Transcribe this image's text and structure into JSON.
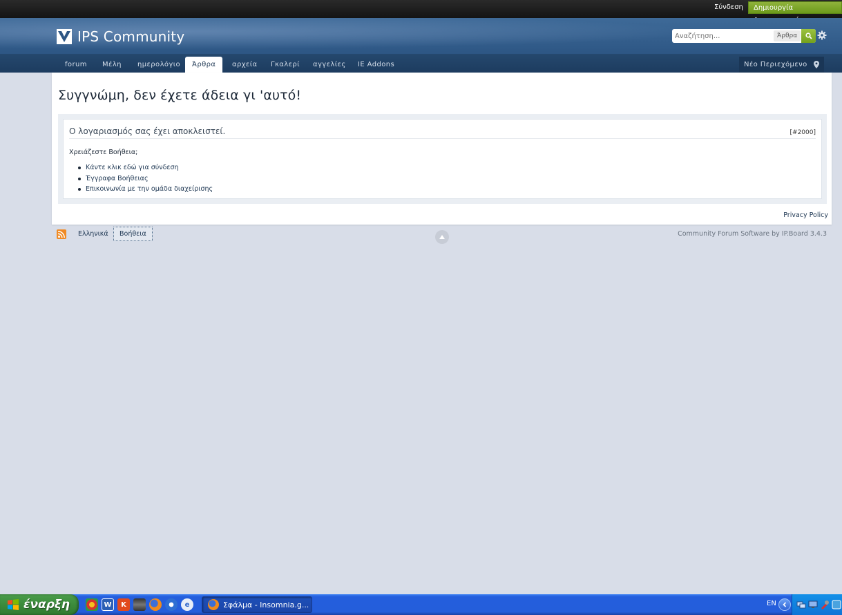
{
  "userbar": {
    "signin_label": "Σύνδεση",
    "register_label": "Δημιουργία Λογαριασμού"
  },
  "header": {
    "logo_text": "IPS Community",
    "search_placeholder": "Αναζήτηση...",
    "search_scope": "Άρθρα"
  },
  "nav": {
    "tabs": [
      {
        "label": "forum"
      },
      {
        "label": "Μέλη"
      },
      {
        "label": "ημερολόγιο"
      },
      {
        "label": "Άρθρα",
        "active": true
      },
      {
        "label": "αρχεία"
      },
      {
        "label": "Γκαλερί"
      },
      {
        "label": "αγγελίες"
      },
      {
        "label": "IE Addons"
      }
    ],
    "new_content_label": "Νέο Περιεχόμενο"
  },
  "content": {
    "page_title": "Συγγνώμη, δεν έχετε άδεια γι 'αυτό!",
    "message_title": "Ο λογαριασμός σας έχει αποκλειστεί.",
    "error_code": "[#2000]",
    "help_label": "Χρειάζεστε Βοήθεια;",
    "help_links": [
      "Κάντε κλικ εδώ για σύνδεση",
      "Έγγραφα Βοήθειας",
      "Επικοινωνία με την ομάδα διαχείρισης"
    ],
    "privacy_label": "Privacy Policy"
  },
  "footer": {
    "language_label": "Ελληνικά",
    "help_label": "Βοήθεια",
    "copyright": "Community Forum Software by IP.Board 3.4.3"
  },
  "taskbar": {
    "start_label": "έναρξη",
    "quick_launch_icons": [
      "chrome-icon",
      "word-icon",
      "k-icon",
      "media-icon",
      "firefox-icon",
      "player-icon",
      "ie-icon"
    ],
    "task_label": "Σφάλμα - Insomnia.g...",
    "language": "EN"
  },
  "colors": {
    "accent_green": "#7aa526",
    "header_blue": "#2d5684",
    "nav_blue": "#1d3c5f",
    "page_bg": "#d8dde8"
  }
}
